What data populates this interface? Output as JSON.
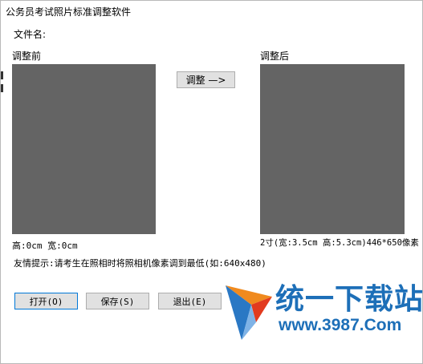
{
  "window": {
    "title": "公务员考试照片标准调整软件"
  },
  "file": {
    "label": "文件名:"
  },
  "before": {
    "label": "调整前",
    "size_info": "高:0cm  宽:0cm"
  },
  "after": {
    "label": "调整后",
    "size_info": "2寸(宽:3.5cm 高:5.3cm)446*650像素"
  },
  "adjust_button": "调整 —>",
  "hint": "友情提示:请考生在照相时将照相机像素调到最低(如:640x480)",
  "buttons": {
    "open": "打开(O)",
    "save": "保存(S)",
    "exit": "退出(E)"
  },
  "watermark": {
    "brand": "统一下载站",
    "site": "www.3987.Com"
  },
  "colors": {
    "photo_placeholder": "#646464",
    "watermark_blue": "#1d6fb8",
    "focus_border": "#0078d7"
  }
}
